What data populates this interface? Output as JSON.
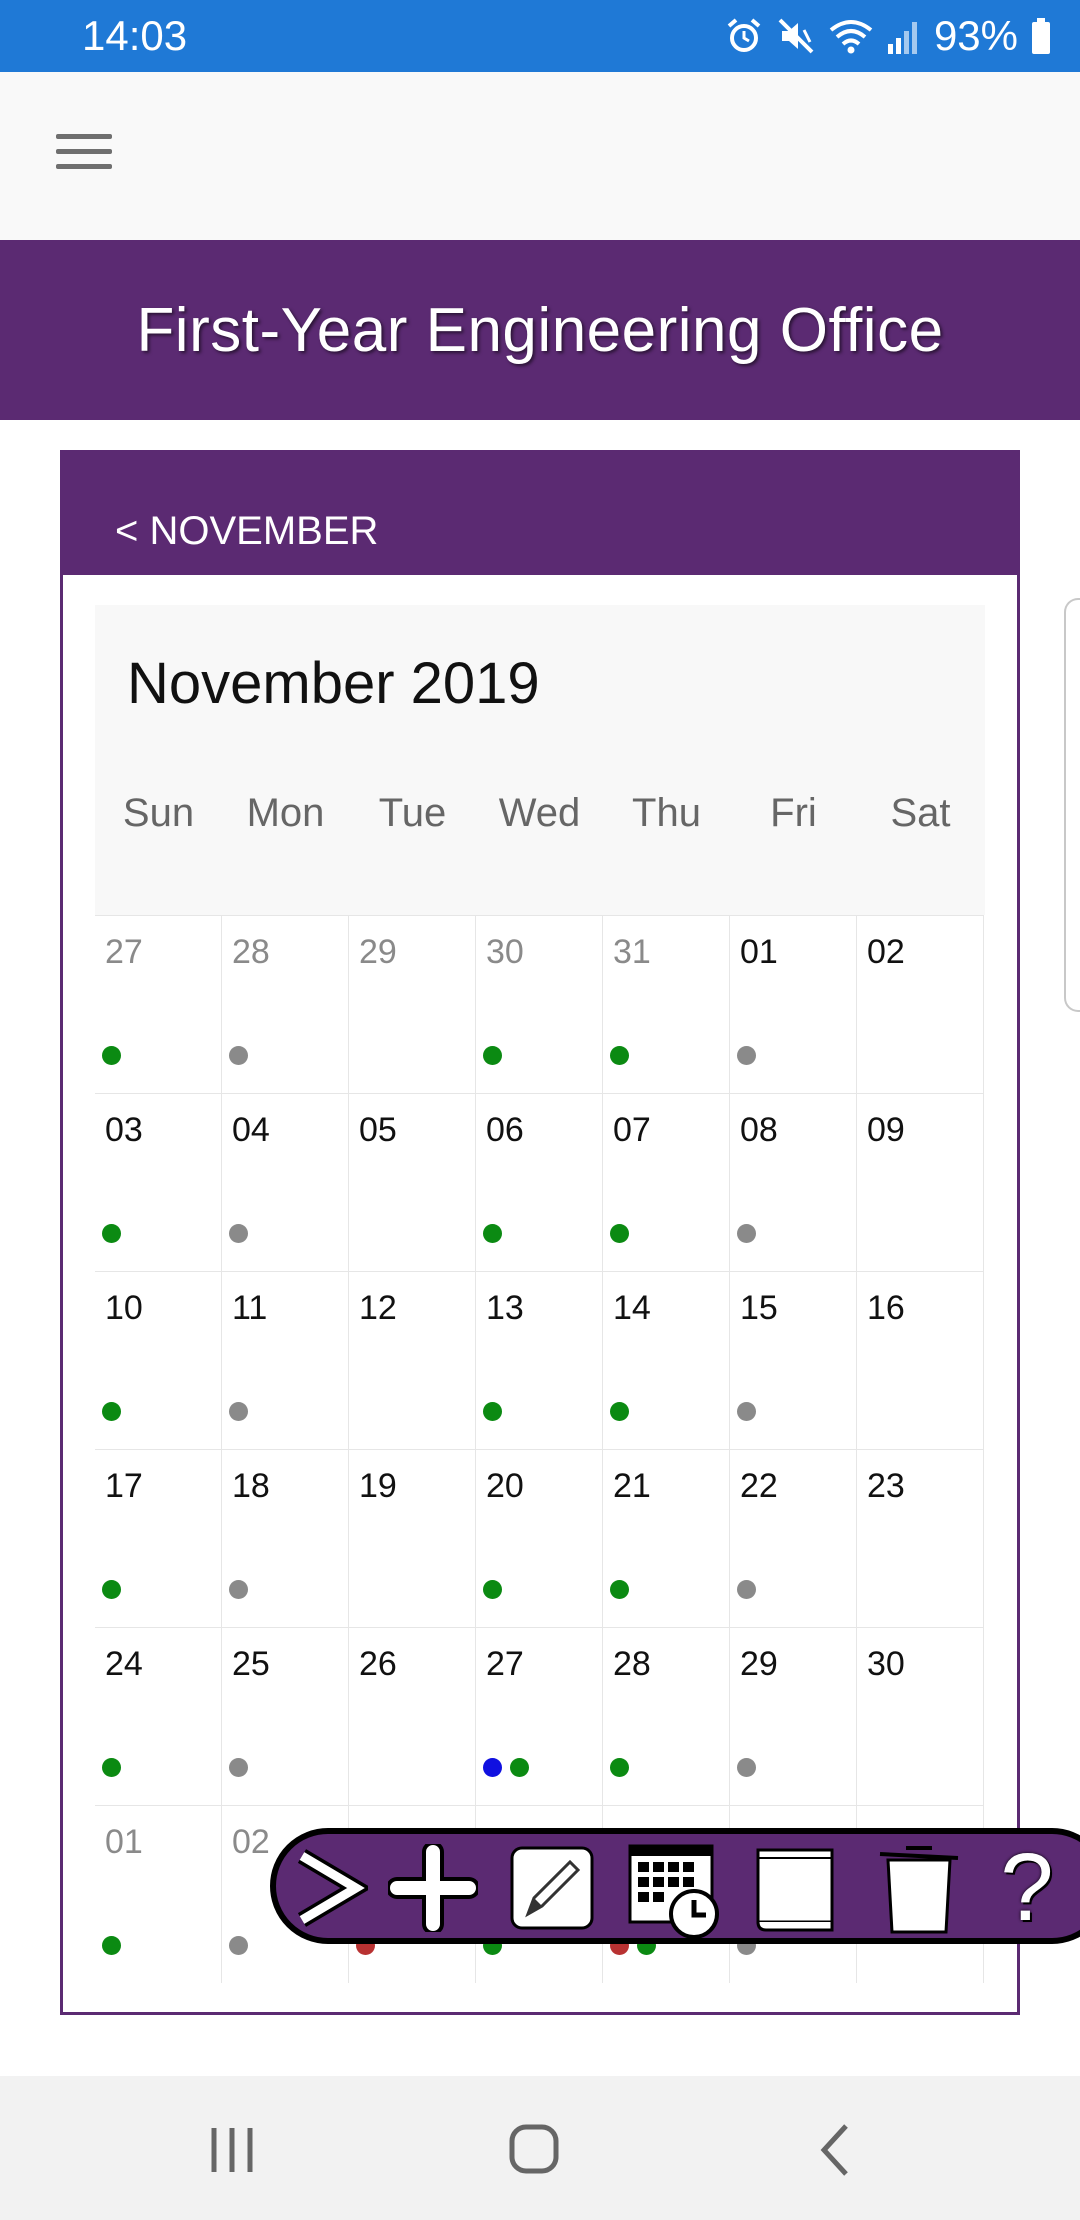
{
  "status_bar": {
    "time": "14:03",
    "battery": "93%",
    "icons": [
      "alarm-icon",
      "mute-icon",
      "wifi-icon",
      "signal-icon",
      "battery-icon"
    ]
  },
  "app_bar": {
    "menu_icon": "hamburger-menu-icon"
  },
  "banner": {
    "title": "First-Year Engineering Office"
  },
  "calendar": {
    "nav_label": "< NOVEMBER",
    "title": "November 2019",
    "weekdays": [
      "Sun",
      "Mon",
      "Tue",
      "Wed",
      "Thu",
      "Fri",
      "Sat"
    ],
    "colors": {
      "green": "#0b8a12",
      "gray": "#8a8a8a",
      "blue": "#1010e0",
      "red": "#b83232",
      "accent": "#5b2a72"
    },
    "weeks": [
      [
        {
          "day": "27",
          "other": true,
          "dots": [
            "green"
          ]
        },
        {
          "day": "28",
          "other": true,
          "dots": [
            "gray"
          ]
        },
        {
          "day": "29",
          "other": true,
          "dots": []
        },
        {
          "day": "30",
          "other": true,
          "dots": [
            "green"
          ]
        },
        {
          "day": "31",
          "other": true,
          "dots": [
            "green"
          ]
        },
        {
          "day": "01",
          "other": false,
          "dots": [
            "gray"
          ]
        },
        {
          "day": "02",
          "other": false,
          "dots": []
        }
      ],
      [
        {
          "day": "03",
          "other": false,
          "dots": [
            "green"
          ]
        },
        {
          "day": "04",
          "other": false,
          "dots": [
            "gray"
          ]
        },
        {
          "day": "05",
          "other": false,
          "dots": []
        },
        {
          "day": "06",
          "other": false,
          "dots": [
            "green"
          ]
        },
        {
          "day": "07",
          "other": false,
          "dots": [
            "green"
          ]
        },
        {
          "day": "08",
          "other": false,
          "dots": [
            "gray"
          ]
        },
        {
          "day": "09",
          "other": false,
          "dots": []
        }
      ],
      [
        {
          "day": "10",
          "other": false,
          "dots": [
            "green"
          ]
        },
        {
          "day": "11",
          "other": false,
          "dots": [
            "gray"
          ]
        },
        {
          "day": "12",
          "other": false,
          "dots": []
        },
        {
          "day": "13",
          "other": false,
          "dots": [
            "green"
          ]
        },
        {
          "day": "14",
          "other": false,
          "dots": [
            "green"
          ]
        },
        {
          "day": "15",
          "other": false,
          "dots": [
            "gray"
          ]
        },
        {
          "day": "16",
          "other": false,
          "dots": []
        }
      ],
      [
        {
          "day": "17",
          "other": false,
          "dots": [
            "green"
          ]
        },
        {
          "day": "18",
          "other": false,
          "dots": [
            "gray"
          ]
        },
        {
          "day": "19",
          "other": false,
          "dots": []
        },
        {
          "day": "20",
          "other": false,
          "dots": [
            "green"
          ]
        },
        {
          "day": "21",
          "other": false,
          "dots": [
            "green"
          ]
        },
        {
          "day": "22",
          "other": false,
          "dots": [
            "gray"
          ]
        },
        {
          "day": "23",
          "other": false,
          "dots": []
        }
      ],
      [
        {
          "day": "24",
          "other": false,
          "dots": [
            "green"
          ]
        },
        {
          "day": "25",
          "other": false,
          "dots": [
            "gray"
          ]
        },
        {
          "day": "26",
          "other": false,
          "dots": []
        },
        {
          "day": "27",
          "other": false,
          "dots": [
            "blue",
            "green"
          ]
        },
        {
          "day": "28",
          "other": false,
          "dots": [
            "green"
          ]
        },
        {
          "day": "29",
          "other": false,
          "dots": [
            "gray"
          ]
        },
        {
          "day": "30",
          "other": false,
          "dots": []
        }
      ],
      [
        {
          "day": "01",
          "other": true,
          "dots": [
            "green"
          ]
        },
        {
          "day": "02",
          "other": true,
          "dots": [
            "gray"
          ]
        },
        {
          "day": "",
          "other": true,
          "dots": [
            "red"
          ]
        },
        {
          "day": "",
          "other": true,
          "dots": [
            "green"
          ]
        },
        {
          "day": "",
          "other": true,
          "dots": [
            "red",
            "green"
          ]
        },
        {
          "day": "",
          "other": true,
          "dots": [
            "gray"
          ]
        },
        {
          "day": "",
          "other": true,
          "dots": []
        }
      ]
    ]
  },
  "toolbar": {
    "buttons": [
      "next-arrow-icon",
      "plus-icon",
      "pencil-icon",
      "calendar-clock-icon",
      "book-icon",
      "trash-can-icon",
      "question-mark-icon"
    ],
    "help_label": "?"
  },
  "nav_bar": {
    "buttons": [
      "recent-apps-icon",
      "home-icon",
      "back-icon"
    ]
  }
}
